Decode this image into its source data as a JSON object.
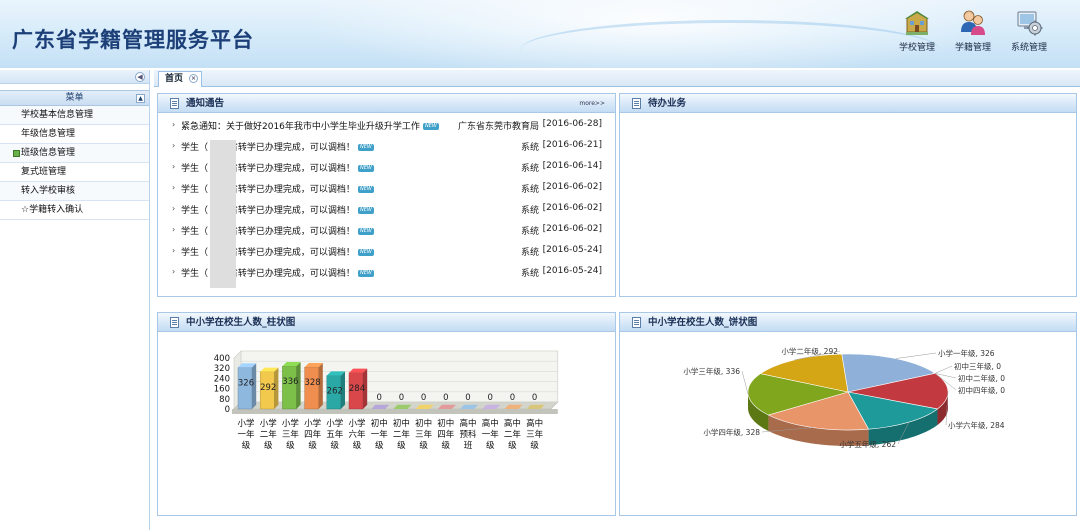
{
  "app": {
    "title": "广东省学籍管理服务平台"
  },
  "topnav": [
    {
      "label": "学校管理",
      "icon": "school-building-icon"
    },
    {
      "label": "学籍管理",
      "icon": "users-icon"
    },
    {
      "label": "系统管理",
      "icon": "gear-computer-icon"
    }
  ],
  "sidebar": {
    "header": "菜单",
    "items": [
      {
        "label": "学校基本信息管理"
      },
      {
        "label": "年级信息管理"
      },
      {
        "label": "班级信息管理",
        "marked": true
      },
      {
        "label": "复式班管理"
      },
      {
        "label": "转入学校审核"
      },
      {
        "label": "☆学籍转入确认"
      }
    ]
  },
  "tabs": [
    {
      "label": "首页"
    }
  ],
  "notice": {
    "title": "通知通告",
    "more": "more>>",
    "badge": "NEW",
    "items": [
      {
        "title": "紧急通知：关于做好2016年我市中小学生毕业升级升学工作",
        "source": "广东省东莞市教育局",
        "date": "[2016-06-28]"
      },
      {
        "title": "学生（      ）跨省转学已办理完成，可以调档！",
        "source": "系统",
        "date": "[2016-06-21]"
      },
      {
        "title": "学生（      ）跨省转学已办理完成，可以调档！",
        "source": "系统",
        "date": "[2016-06-14]"
      },
      {
        "title": "学生（      ）跨省转学已办理完成，可以调档！",
        "source": "系统",
        "date": "[2016-06-02]"
      },
      {
        "title": "学生（      ）跨省转学已办理完成，可以调档！",
        "source": "系统",
        "date": "[2016-06-02]"
      },
      {
        "title": "学生（      ）跨省转学已办理完成，可以调档！",
        "source": "系统",
        "date": "[2016-06-02]"
      },
      {
        "title": "学生（      ）跨省转学已办理完成，可以调档！",
        "source": "系统",
        "date": "[2016-05-24]"
      },
      {
        "title": "学生（      ）跨省转学已办理完成，可以调档！",
        "source": "系统",
        "date": "[2016-05-24]"
      }
    ]
  },
  "todo": {
    "title": "待办业务"
  },
  "bar_panel": {
    "title": "中小学在校生人数_柱状图"
  },
  "pie_panel": {
    "title": "中小学在校生人数_饼状图"
  },
  "chart_data": [
    {
      "type": "bar",
      "categories": [
        "小学一年级",
        "小学二年级",
        "小学三年级",
        "小学四年级",
        "小学五年级",
        "小学六年级",
        "初中一年级",
        "初中二年级",
        "初中三年级",
        "初中四年级",
        "高中预科班",
        "高中一年级",
        "高中二年级",
        "高中三年级"
      ],
      "category_lines": [
        [
          "小学",
          "一年",
          "级"
        ],
        [
          "小学",
          "二年",
          "级"
        ],
        [
          "小学",
          "三年",
          "级"
        ],
        [
          "小学",
          "四年",
          "级"
        ],
        [
          "小学",
          "五年",
          "级"
        ],
        [
          "小学",
          "六年",
          "级"
        ],
        [
          "初中",
          "一年",
          "级"
        ],
        [
          "初中",
          "二年",
          "级"
        ],
        [
          "初中",
          "三年",
          "级"
        ],
        [
          "初中",
          "四年",
          "级"
        ],
        [
          "高中",
          "预科",
          "班"
        ],
        [
          "高中",
          "一年",
          "级"
        ],
        [
          "高中",
          "二年",
          "级"
        ],
        [
          "高中",
          "三年",
          "级"
        ]
      ],
      "values": [
        326,
        292,
        336,
        328,
        262,
        284,
        0,
        0,
        0,
        0,
        0,
        0,
        0,
        0
      ],
      "colors": [
        "#8fb8de",
        "#f2c94c",
        "#7cc04a",
        "#f08e4f",
        "#2aa8a6",
        "#d9474b",
        "#b6a6d9",
        "#9ccb6b",
        "#f0d36a",
        "#e39a9a",
        "#9cc4e6",
        "#c9b3e2",
        "#f0b27a",
        "#d8c77a"
      ],
      "yticks": [
        0,
        80,
        160,
        240,
        320,
        400
      ],
      "ylim": [
        0,
        400
      ],
      "grid": true
    },
    {
      "type": "pie",
      "labels": [
        "小学一年级",
        "初中三年级",
        "初中二年级",
        "初中四年级",
        "小学六年级",
        "小学五年级",
        "小学四年级",
        "小学三年级",
        "小学二年级"
      ],
      "values": [
        326,
        0,
        0,
        0,
        284,
        262,
        328,
        336,
        292
      ],
      "label_texts": [
        "小学一年级, 326",
        "初中三年级, 0",
        "初中二年级, 0",
        "初中四年级, 0",
        "小学六年级, 284",
        "小学五年级, 262",
        "小学四年级, 328",
        "小学三年级, 336",
        "小学二年级, 292"
      ],
      "colors": [
        "#8fb0d8",
        "#c9a24a",
        "#7a9a3a",
        "#a06a4a",
        "#c23a3f",
        "#1f9a9a",
        "#e9956a",
        "#7fa61c",
        "#d4a514"
      ]
    }
  ]
}
